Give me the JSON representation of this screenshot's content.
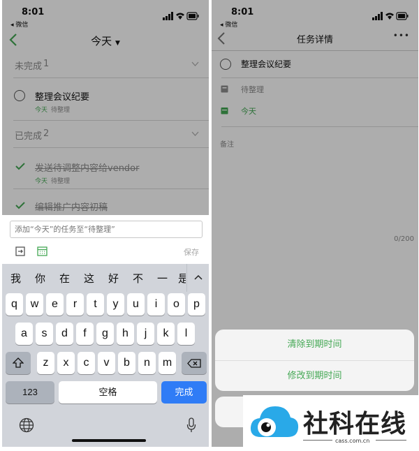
{
  "colors": {
    "accent": "#44a854",
    "blue_key": "#2f7cf6",
    "overlay": "rgba(0,0,0,0.32)"
  },
  "status": {
    "time": "8:01",
    "back_app": "◂ 微信"
  },
  "left": {
    "nav_title": "今天",
    "sections": {
      "incomplete_label": "未完成",
      "incomplete_count": "1",
      "complete_label": "已完成",
      "complete_count": "2"
    },
    "tasks_pending": [
      {
        "title": "整理会议纪要",
        "date": "今天",
        "list": "待整理"
      }
    ],
    "tasks_done": [
      {
        "title": "发送待调整内容给vendor",
        "date": "今天",
        "list": "待整理"
      },
      {
        "title": "编辑推广内容初稿"
      }
    ],
    "input": {
      "placeholder": "添加“今天”的任务至“待整理”",
      "save_label": "保存"
    },
    "keyboard": {
      "candidates": [
        "我",
        "你",
        "在",
        "这",
        "好",
        "不",
        "一",
        "是"
      ],
      "row1": [
        "q",
        "w",
        "e",
        "r",
        "t",
        "y",
        "u",
        "i",
        "o",
        "p"
      ],
      "row2": [
        "a",
        "s",
        "d",
        "f",
        "g",
        "h",
        "j",
        "k",
        "l"
      ],
      "row3": [
        "z",
        "x",
        "c",
        "v",
        "b",
        "n",
        "m"
      ],
      "num_label": "123",
      "space_label": "空格",
      "done_label": "完成"
    }
  },
  "right": {
    "nav_title": "任务详情",
    "more_label": "•••",
    "task_title": "整理会议纪要",
    "list_label": "待整理",
    "date_label": "今天",
    "notes_label": "备注",
    "char_count": "0/200",
    "sheet": {
      "clear_label": "清除到期时间",
      "modify_label": "修改到期时间"
    }
  },
  "watermark": {
    "name": "社科在线",
    "url": "cass.com.cn"
  }
}
